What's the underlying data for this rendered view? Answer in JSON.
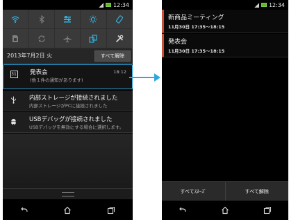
{
  "status_bar": {
    "time": "12:34"
  },
  "left_screen": {
    "quick_settings": [
      {
        "icon": "wifi-icon",
        "active": true
      },
      {
        "icon": "bluetooth-icon",
        "active": false
      },
      {
        "icon": "sliders-icon",
        "active": true
      },
      {
        "icon": "brightness-icon",
        "active": true
      },
      {
        "icon": "rotation-icon",
        "active": true
      },
      {
        "icon": "sim-icon",
        "active": false
      },
      {
        "icon": "sync-icon",
        "active": false
      },
      {
        "icon": "airplane-icon",
        "active": false
      },
      {
        "icon": "screen-mirror-icon",
        "active": true
      },
      {
        "icon": "settings-tools-icon",
        "active": false
      }
    ],
    "date": "2013年7月2日 火",
    "clear_all_label": "すべて解除",
    "notifications": [
      {
        "title": "発表会",
        "subtitle": "(他１件の通知があります)",
        "time": "18:12",
        "icon": "calendar-icon"
      },
      {
        "title": "内部ストレージが接続されました",
        "subtitle": "内部ストレージがPCに接続されました",
        "icon": "usb-icon"
      },
      {
        "title": "USBデバッグが接続されました",
        "subtitle": "USBデバッグを無効にする場合に選択します。",
        "icon": "android-icon"
      }
    ],
    "accent_color": "#2ea7e0"
  },
  "right_screen": {
    "events": [
      {
        "title": "新商品ミーティング",
        "time": "11月30日 17:35～18:15"
      },
      {
        "title": "発表会",
        "time": "11月30日 17:35～18:15"
      }
    ],
    "snooze_all_label": "すべてｽﾇｰｽﾞ",
    "dismiss_all_label": "すべて解除",
    "accent_color": "#c8503a"
  }
}
